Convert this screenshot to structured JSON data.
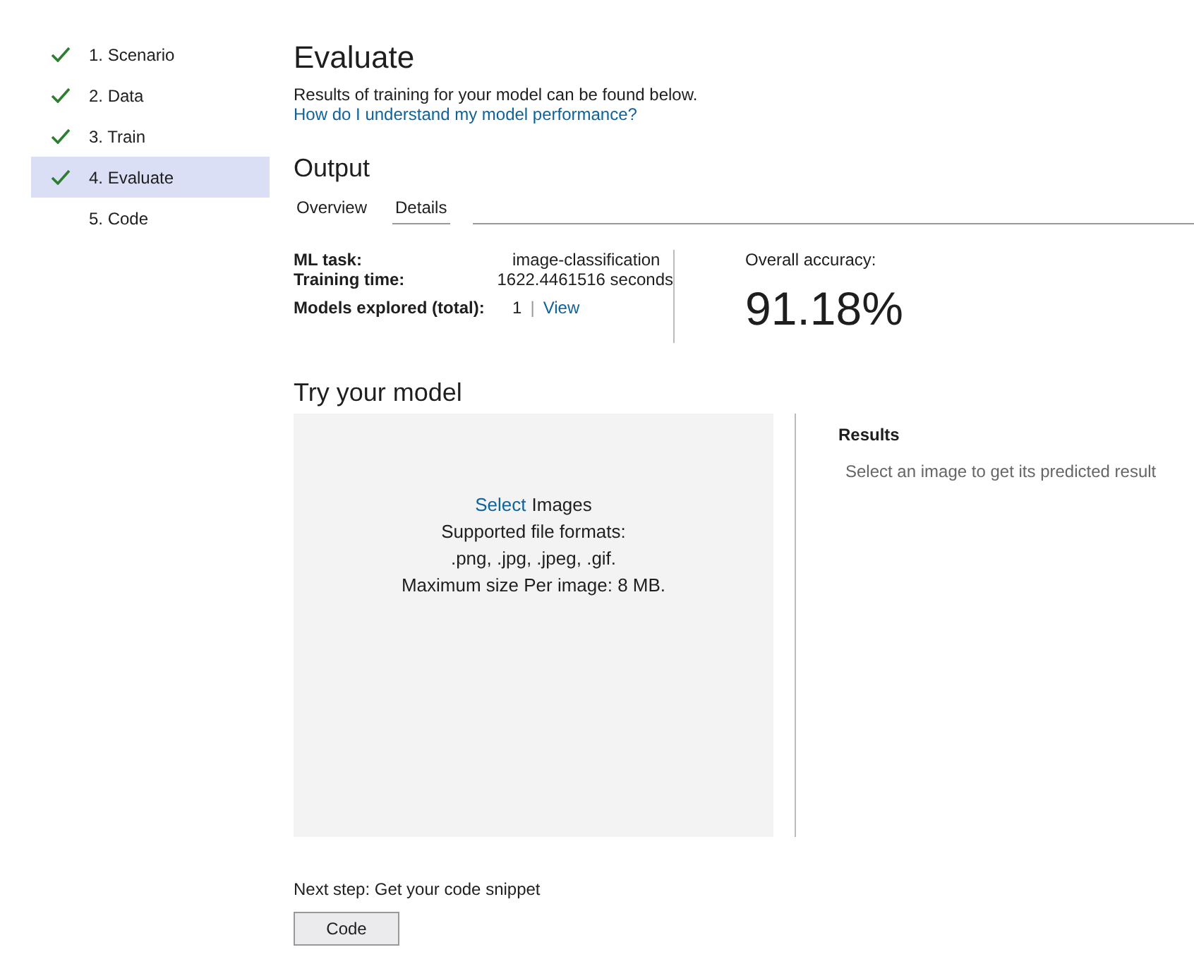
{
  "steps": [
    {
      "label": "1. Scenario",
      "done": true,
      "selected": false
    },
    {
      "label": "2. Data",
      "done": true,
      "selected": false
    },
    {
      "label": "3. Train",
      "done": true,
      "selected": false
    },
    {
      "label": "4. Evaluate",
      "done": true,
      "selected": true
    },
    {
      "label": "5. Code",
      "done": false,
      "selected": false
    }
  ],
  "title": "Evaluate",
  "subtitle": "Results of training for your model can be found below.",
  "help_link": "How do I understand my model performance?",
  "output": {
    "heading": "Output",
    "tabs": [
      {
        "label": "Overview",
        "selected": true
      },
      {
        "label": "Details",
        "selected": false
      }
    ],
    "metrics": [
      {
        "label": "ML task:",
        "value": "image-classification"
      },
      {
        "label": "Training time:",
        "value": "1622.4461516 seconds"
      }
    ],
    "models_label": "Models explored (total):",
    "models_count": "1",
    "separator": "|",
    "view_link": "View",
    "accuracy_label": "Overall accuracy:",
    "accuracy": "91.18%"
  },
  "try": {
    "heading": "Try your model",
    "select_link": "Select",
    "select_rest": "Images",
    "formats_label": "Supported file formats:",
    "formats": ".png, .jpg, .jpeg, .gif.",
    "max_size": "Maximum size Per image: 8 MB.",
    "results_heading": "Results",
    "results_hint": "Select an image to get its predicted result"
  },
  "next_step": "Next step: Get your code snippet",
  "code_button": "Code"
}
